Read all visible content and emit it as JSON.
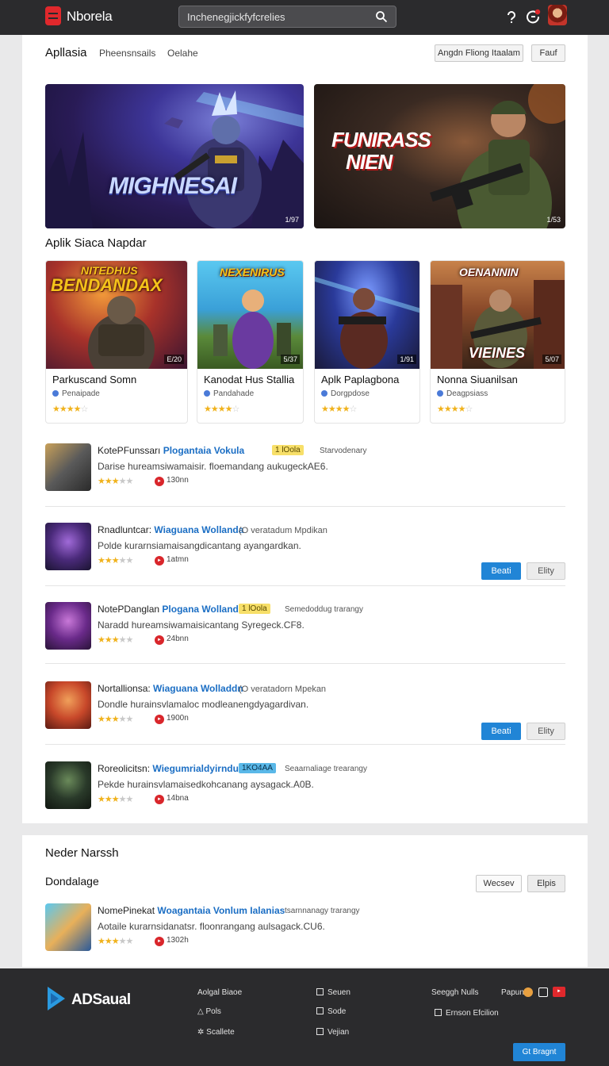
{
  "header": {
    "brand": "Nborela",
    "search_value": "Inchenegjickfyfcrelies"
  },
  "subnav": {
    "tabs": [
      "Apllasia",
      "Pheensnsails",
      "Oelahe"
    ],
    "btn_primary": "Angdn Fliong Itaalam",
    "btn_secondary": "Fauf"
  },
  "heroes": [
    {
      "title": "MIGHNESAI",
      "badge": "1/97"
    },
    {
      "title_line1": "FUNIRASS",
      "title_line2": "NIEN",
      "badge": "1/53"
    }
  ],
  "section_featured": "Aplik Siaca Napdar",
  "cards": [
    {
      "art_title": "BENDANDAX",
      "art_top": "NITEDHUS",
      "badge": "E/20",
      "title": "Parkuscand Somn",
      "sub": "Penaipade",
      "rating": 4.5
    },
    {
      "art_title": "NEXENIRUS",
      "badge": "5/37",
      "title": "Kanodat Hus Stallia",
      "sub": "Pandahade",
      "rating": 4.5
    },
    {
      "art_title": "",
      "badge": "1/91",
      "title": "Aplk Paplagbona",
      "sub": "Dorgpdose",
      "rating": 4.5
    },
    {
      "art_title": "VIEINES",
      "art_top": "OENANNIN",
      "badge": "5/07",
      "title": "Nonna Siuanilsan",
      "sub": "Deagpsiass",
      "rating": 4.5
    }
  ],
  "rows": [
    {
      "prefix": "KotePFunssarı",
      "highlight": "Plogantaia Vokula",
      "tag": "1 lOola",
      "tag_bg": "#f7df69",
      "meta": "Starvodenary",
      "desc": "Darise hureamsiwamaisir. floemandang aukugeckAE6.",
      "rating": 3.5,
      "count": "130nn",
      "buttons": null
    },
    {
      "prefix": "Rnadluntcar:",
      "highlight": "Wiaguana Wollanda",
      "tag": "",
      "tag_bg": "",
      "meta": "(O veratadum  Mpdikan",
      "desc": "Polde kurarnsiamaisangdicantang ayangardkan.",
      "rating": 3.5,
      "count": "1atmn",
      "buttons": [
        "Beati",
        "Elity"
      ]
    },
    {
      "prefix": "NotePDanglan",
      "highlight": "Plogana Wollanda",
      "tag": "1 lOola",
      "tag_bg": "#f7df69",
      "meta": "Semedoddug trarangy",
      "desc": "Naradd hureamsiwamaisicantang Syregeck.CF8.",
      "rating": 3.5,
      "count": "24bnn",
      "buttons": null
    },
    {
      "prefix": "Nortallionsa:",
      "highlight": "Wiaguana Wolladdn",
      "tag": "",
      "tag_bg": "",
      "meta": "(O veratadorn  Mpekan",
      "desc": "Dondle hurainsvlamaloc modleanengdyagardivan.",
      "rating": 3.5,
      "count": "1900n",
      "buttons": [
        "Beati",
        "Elity"
      ]
    },
    {
      "prefix": "Roreolicitsn:",
      "highlight": "Wiegumrialdyirndun",
      "tag": "1KO4AA",
      "tag_bg": "#5ab8e8",
      "meta": "Seaarnaliage trearangy",
      "desc": "Pekde hurainsvlamaisedkohcanang aysagack.A0B.",
      "rating": 3.5,
      "count": "14bna",
      "buttons": null
    }
  ],
  "section_2": {
    "title": "Neder Narssh",
    "subtitle": "Dondalage",
    "btn_a": "Wecsev",
    "btn_b": "Elpis",
    "row": {
      "prefix": "NomePinekat",
      "highlight": "Woagantaia Vonlum Ialanias",
      "meta": "tsarnnanagy trarangy",
      "desc": "Aotaile kurarnsidanatsr. floonrangang aulsagack.CU6.",
      "rating": 3.5,
      "count": "1302h"
    }
  },
  "footer": {
    "brand": "ADSaual",
    "col1": [
      "Aolgal Biaoe",
      "Pols",
      "Scallete"
    ],
    "col2": [
      "Seuen",
      "Sode",
      "Vejian"
    ],
    "col3": [
      "Seeggh Nulls",
      "Ernson  Efcilion"
    ],
    "col4": "Papun",
    "cta": "Gt Bragnt"
  },
  "colors": {
    "accent": "#2185d6",
    "brand_red": "#e0282c",
    "star": "#f0b21c",
    "header_bg": "#2b2b2d"
  }
}
